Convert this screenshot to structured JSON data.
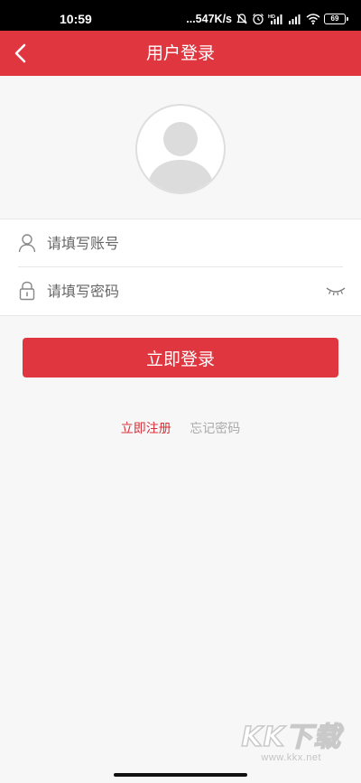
{
  "status_bar": {
    "time": "10:59",
    "network_speed": "...547K/s",
    "battery_level": "69",
    "icons": [
      "alarm-off-icon",
      "alarm-clock-icon",
      "signal-hd-icon",
      "signal-icon",
      "wifi-icon",
      "battery-icon"
    ]
  },
  "nav": {
    "title": "用户登录",
    "back_icon": "chevron-left-icon"
  },
  "avatar": {
    "icon": "default-user-avatar-icon"
  },
  "form": {
    "account": {
      "placeholder": "请填写账号",
      "icon": "user-icon"
    },
    "password": {
      "placeholder": "请填写密码",
      "icon": "lock-icon",
      "toggle_icon": "eye-closed-icon"
    }
  },
  "actions": {
    "login_label": "立即登录",
    "register_label": "立即注册",
    "forgot_label": "忘记密码"
  },
  "watermark": {
    "logo": "KK下载",
    "url": "www.kkx.net"
  },
  "colors": {
    "brand": "#e0363f",
    "register_link": "#d8303a",
    "forgot_link": "#aaaaaa",
    "background": "#f7f7f7"
  }
}
